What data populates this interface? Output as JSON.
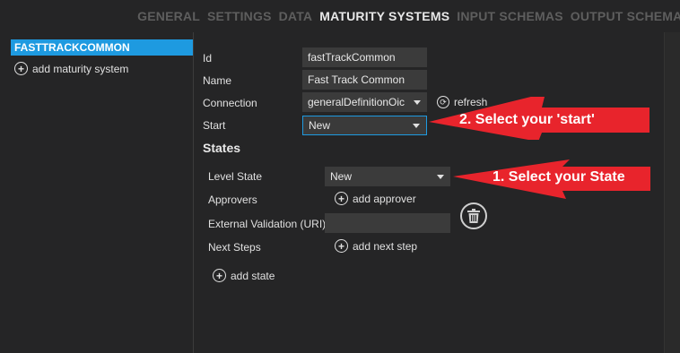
{
  "nav": {
    "tabs": [
      "GENERAL",
      "SETTINGS",
      "DATA",
      "MATURITY SYSTEMS",
      "INPUT SCHEMAS",
      "OUTPUT SCHEMAS"
    ],
    "active": "MATURITY SYSTEMS"
  },
  "sidebar": {
    "selected_item": "FASTTRACKCOMMON",
    "add_label": "add maturity system"
  },
  "form": {
    "id_label": "Id",
    "id_value": "fastTrackCommon",
    "name_label": "Name",
    "name_value": "Fast Track Common",
    "connection_label": "Connection",
    "connection_value": "generalDefinitionOic",
    "refresh_label": "refresh",
    "start_label": "Start",
    "start_value": "New"
  },
  "states": {
    "heading": "States",
    "level_state_label": "Level State",
    "level_state_value": "New",
    "approvers_label": "Approvers",
    "add_approver_label": "add approver",
    "external_validation_label": "External Validation (URI)",
    "external_validation_value": "",
    "next_steps_label": "Next Steps",
    "add_next_step_label": "add next step",
    "add_state_label": "add state"
  },
  "annotations": {
    "arrow1": "1. Select your State",
    "arrow2": "2. Select your 'start'"
  },
  "colors": {
    "background": "#252526",
    "accent": "#1e9ae0",
    "field": "#3b3b3b",
    "arrow": "#e8242c"
  }
}
